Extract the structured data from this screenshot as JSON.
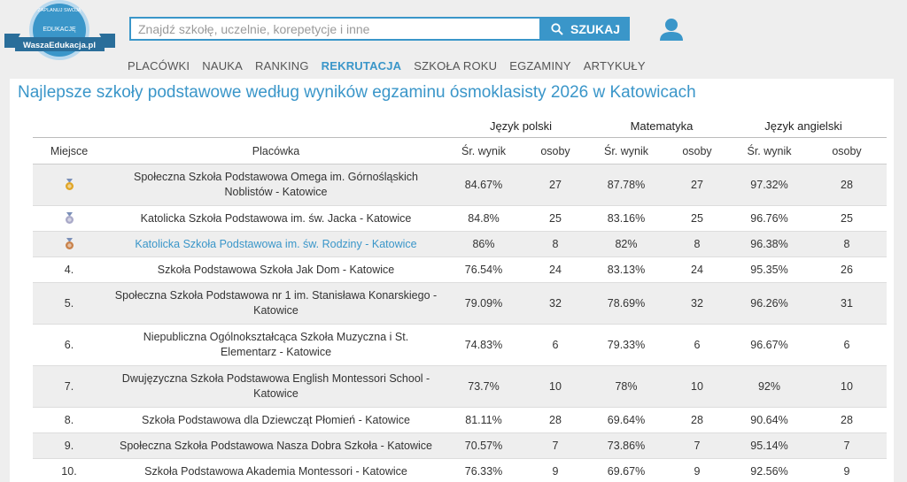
{
  "logo": {
    "top_text": "ZAPLANUJ SWOJĄ",
    "mid_text": "EDUKACJĘ",
    "brand": "WaszaEdukacja.pl"
  },
  "search": {
    "placeholder": "Znajdź szkołę, uczelnie, korepetycje i inne",
    "button_label": "SZUKAJ"
  },
  "nav": {
    "items": [
      {
        "label": "PLACÓWKI"
      },
      {
        "label": "NAUKA"
      },
      {
        "label": "RANKING"
      },
      {
        "label": "REKRUTACJA",
        "active": true
      },
      {
        "label": "SZKOŁA ROKU"
      },
      {
        "label": "EGZAMINY"
      },
      {
        "label": "ARTYKUŁY"
      }
    ]
  },
  "page": {
    "title": "Najlepsze szkoły podstawowe według wyników egzaminu ósmoklasisty 2026 w Katowicach"
  },
  "table": {
    "groups": {
      "polish": "Język polski",
      "math": "Matematyka",
      "english": "Język angielski"
    },
    "headers": {
      "place": "Miejsce",
      "school": "Placówka",
      "pl_avg": "Śr. wynik",
      "pl_n": "osoby",
      "ma_avg": "Śr. wynik",
      "ma_n": "osoby",
      "en_avg": "Śr. wynik",
      "en_n": "osoby"
    },
    "rows": [
      {
        "place": "",
        "medal": "gold",
        "school": "Społeczna Szkoła Podstawowa Omega im. Górnośląskich Noblistów - Katowice",
        "pl_avg": "84.67%",
        "pl_n": "27",
        "ma_avg": "87.78%",
        "ma_n": "27",
        "en_avg": "97.32%",
        "en_n": "28"
      },
      {
        "place": "",
        "medal": "silver",
        "school": "Katolicka Szkoła Podstawowa im. św. Jacka - Katowice",
        "pl_avg": "84.8%",
        "pl_n": "25",
        "ma_avg": "83.16%",
        "ma_n": "25",
        "en_avg": "96.76%",
        "en_n": "25"
      },
      {
        "place": "",
        "medal": "bronze",
        "school": "Katolicka Szkoła Podstawowa im. św. Rodziny - Katowice",
        "pl_avg": "86%",
        "pl_n": "8",
        "ma_avg": "82%",
        "ma_n": "8",
        "en_avg": "96.38%",
        "en_n": "8"
      },
      {
        "place": "4.",
        "school": "Szkoła Podstawowa Szkoła Jak Dom - Katowice",
        "pl_avg": "76.54%",
        "pl_n": "24",
        "ma_avg": "83.13%",
        "ma_n": "24",
        "en_avg": "95.35%",
        "en_n": "26"
      },
      {
        "place": "5.",
        "school": "Społeczna Szkoła Podstawowa nr 1 im. Stanisława Konarskiego - Katowice",
        "pl_avg": "79.09%",
        "pl_n": "32",
        "ma_avg": "78.69%",
        "ma_n": "32",
        "en_avg": "96.26%",
        "en_n": "31"
      },
      {
        "place": "6.",
        "school": "Niepubliczna Ogólnokształcąca Szkoła Muzyczna i St. Elementarz - Katowice",
        "pl_avg": "74.83%",
        "pl_n": "6",
        "ma_avg": "79.33%",
        "ma_n": "6",
        "en_avg": "96.67%",
        "en_n": "6"
      },
      {
        "place": "7.",
        "school": "Dwujęzyczna Szkoła Podstawowa English Montessori School - Katowice",
        "pl_avg": "73.7%",
        "pl_n": "10",
        "ma_avg": "78%",
        "ma_n": "10",
        "en_avg": "92%",
        "en_n": "10"
      },
      {
        "place": "8.",
        "school": "Szkoła Podstawowa dla Dziewcząt Płomień - Katowice",
        "pl_avg": "81.11%",
        "pl_n": "28",
        "ma_avg": "69.64%",
        "ma_n": "28",
        "en_avg": "90.64%",
        "en_n": "28"
      },
      {
        "place": "9.",
        "school": "Społeczna Szkoła Podstawowa Nasza Dobra Szkoła - Katowice",
        "pl_avg": "70.57%",
        "pl_n": "7",
        "ma_avg": "73.86%",
        "ma_n": "7",
        "en_avg": "95.14%",
        "en_n": "7"
      },
      {
        "place": "10.",
        "school": "Szkoła Podstawowa Akademia Montessori - Katowice",
        "pl_avg": "76.33%",
        "pl_n": "9",
        "ma_avg": "69.67%",
        "ma_n": "9",
        "en_avg": "92.56%",
        "en_n": "9"
      }
    ]
  },
  "colors": {
    "accent": "#3a96c9",
    "row_gray": "#eeeeee",
    "gold": "#e0a526",
    "silver": "#a9a9c8",
    "bronze": "#c9824a"
  }
}
